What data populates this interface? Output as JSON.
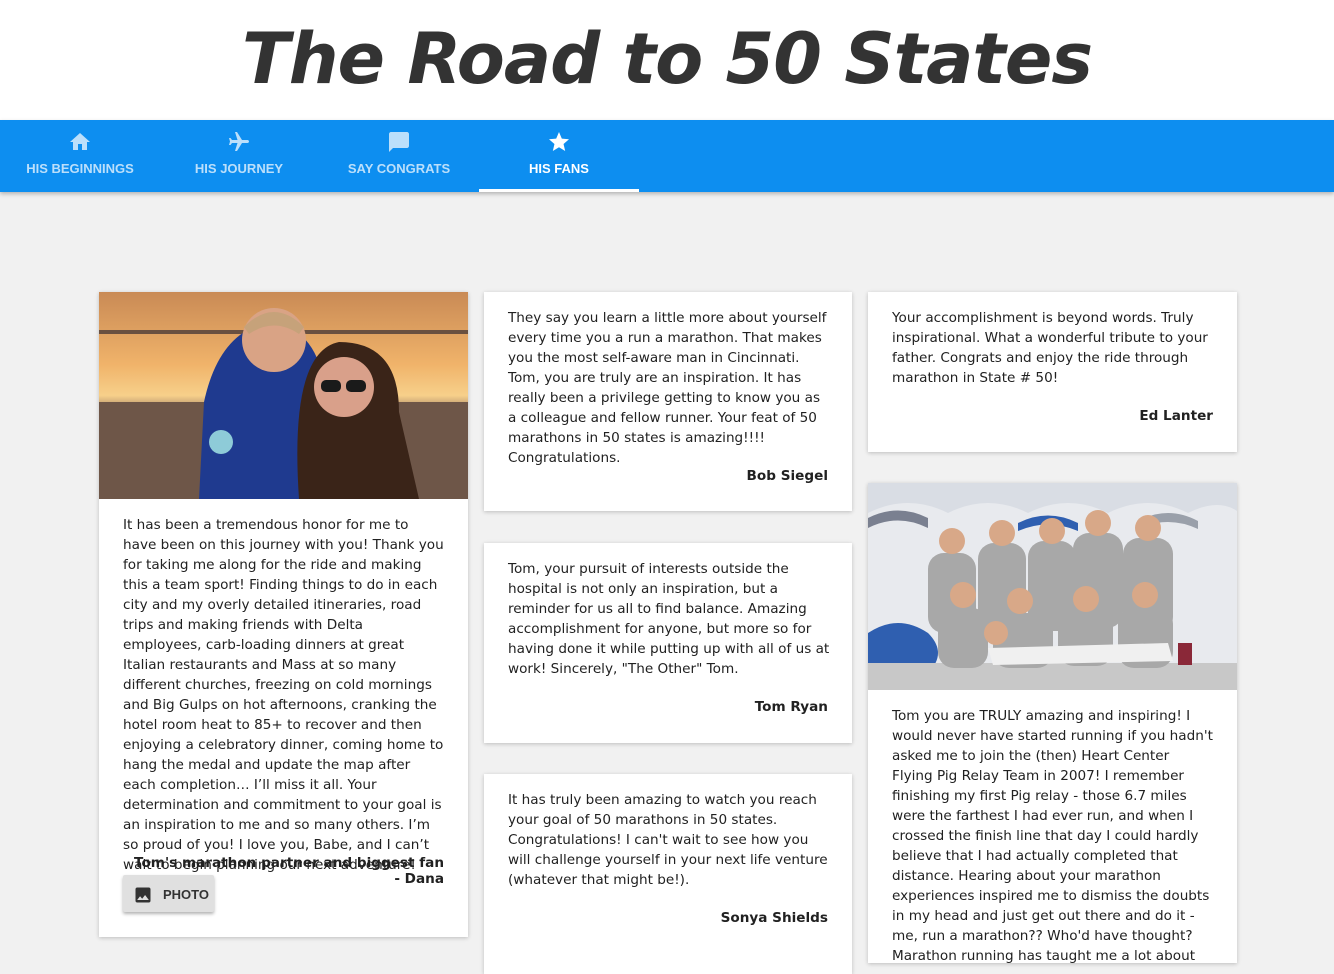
{
  "site": {
    "title": "The Road to 50 States"
  },
  "nav": {
    "tabs": [
      {
        "label": "HIS BEGINNINGS",
        "icon": "home-icon"
      },
      {
        "label": "HIS JOURNEY",
        "icon": "airplane-icon"
      },
      {
        "label": "SAY CONGRATS",
        "icon": "chat-bubble-icon"
      },
      {
        "label": "HIS FANS",
        "icon": "star-icon",
        "active": true
      }
    ]
  },
  "colors": {
    "nav_bg": "#0d8ef0",
    "page_bg": "#f1f1f1",
    "card_bg": "#ffffff",
    "title": "#333333"
  },
  "cards": {
    "dana": {
      "text": "It has been a tremendous honor for me to have been on this journey with you! Thank you for taking me along for the ride and making this a team sport! Finding things to do in each city and my overly detailed itineraries, road trips and making friends with Delta employees, carb-loading dinners at great Italian restaurants and Mass at so many different churches, freezing on cold mornings and Big Gulps on hot afternoons, cranking the hotel room heat to 85+ to recover and then enjoying a celebratory dinner, coming home to hang the medal and update the map after each completion… I’ll miss it all. Your determination and commitment to your goal is an inspiration to me and so many others. I’m so proud of you! I love you, Babe, and I can’t wait to begin planning our next adventure!",
      "signature": "Tom's marathon partner and biggest fan - Dana",
      "button_label": "PHOTO"
    },
    "bob": {
      "text": "They say you learn a little more about yourself every time you a run a marathon.   That makes you the most self-aware man in Cincinnati.  Tom, you are truly are an inspiration.   It has really been a privilege getting to know you as a colleague and fellow runner.   Your feat of 50 marathons in 50 states is amazing!!!!   Congratulations.",
      "signature": "Bob Siegel"
    },
    "tomryan": {
      "text": "Tom, your pursuit of interests outside the hospital is not only an inspiration, but a reminder for us all to find balance. Amazing accomplishment for anyone, but more so for having done it while putting up with all of us at work! Sincerely, \"The Other\" Tom.",
      "signature": "Tom Ryan"
    },
    "sonya": {
      "text": "It has truly been amazing to watch you reach your goal of 50 marathons in 50 states. Congratulations!  I can't wait to see how you will challenge yourself in your next life venture (whatever that might be!).",
      "signature": "Sonya Shields"
    },
    "ed": {
      "text": "Your accomplishment is beyond words. Truly inspirational. What a wonderful tribute to your father. Congrats and enjoy the ride through marathon in State # 50!",
      "signature": "Ed Lanter"
    },
    "relay": {
      "text": "Tom you are TRULY amazing and inspiring! I would never have started running if you hadn't asked me to join the (then) Heart Center Flying Pig Relay Team in 2007! I remember finishing my first Pig relay - those 6.7 miles were the farthest I had ever run, and when I crossed the finish line that day I could hardly believe that I had actually completed that distance. Hearing about your marathon experiences inspired me to dismiss the doubts in my head and just get out there and do it - me, run a marathon?? Who'd have thought? Marathon running has taught me a lot about perseverance and just"
    }
  }
}
